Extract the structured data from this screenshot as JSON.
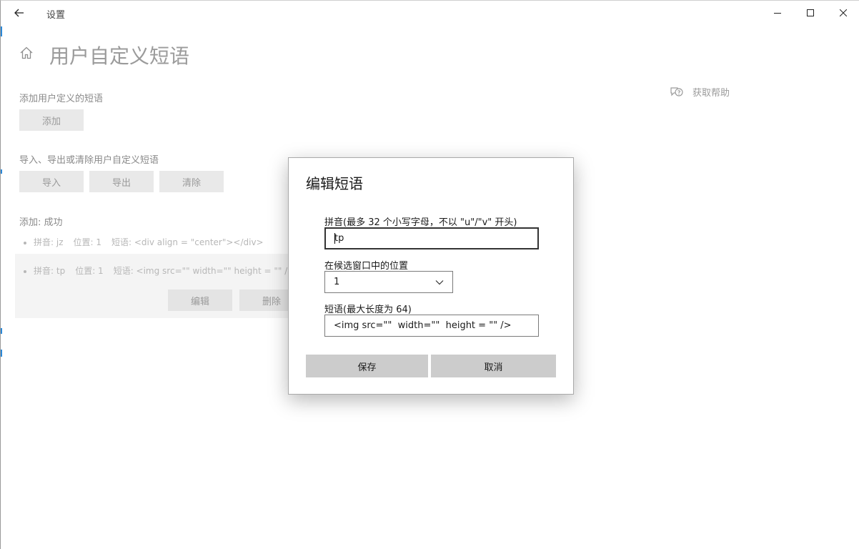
{
  "window": {
    "title": "设置"
  },
  "page": {
    "title": "用户自定义短语",
    "help_label": "获取帮助",
    "add_section": {
      "label": "添加用户定义的短语",
      "add_button": "添加"
    },
    "io_section": {
      "label": "导入、导出或清除用户自定义短语",
      "import_button": "导入",
      "export_button": "导出",
      "clear_button": "清除"
    },
    "status": "添加: 成功",
    "phrases": [
      {
        "pinyin": "拼音: jz",
        "position": "位置: 1",
        "phrase": "短语: <div align = \"center\"></div>"
      },
      {
        "pinyin": "拼音: tp",
        "position": "位置: 1",
        "phrase": "短语: <img src=\"\"  width=\"\"  height = \"\" />"
      }
    ],
    "selected_actions": {
      "edit_button": "编辑",
      "delete_button": "删除"
    }
  },
  "dialog": {
    "title": "编辑短语",
    "pinyin_label": "拼音(最多 32 个小写字母，不以 \"u\"/\"v\" 开头)",
    "pinyin_value": "tp",
    "position_label": "在候选窗口中的位置",
    "position_value": "1",
    "phrase_label": "短语(最大长度为 64)",
    "phrase_value": "<img src=\"\"  width=\"\"  height = \"\" />",
    "save_button": "保存",
    "cancel_button": "取消"
  },
  "colors": {
    "accent": "#2b88d8",
    "dimmed_text": "#9b9b9b",
    "button_gray": "#cccccc"
  },
  "icons": [
    "back-arrow-icon",
    "minimize-icon",
    "maximize-icon",
    "close-icon",
    "home-icon",
    "help-chat-icon",
    "chevron-down-icon"
  ]
}
